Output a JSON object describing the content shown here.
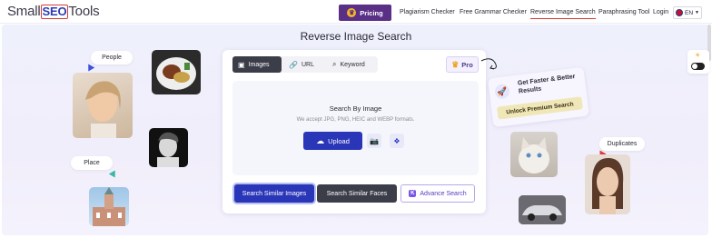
{
  "brand": {
    "logo_pre": "Small",
    "logo_mid": "SEO",
    "logo_post": "Tools"
  },
  "nav": {
    "pricing": "Pricing",
    "links": [
      "Plagiarism Checker",
      "Free Grammar Checker",
      "Reverse Image Search",
      "Paraphrasing Tool",
      "Login"
    ],
    "lang": "EN"
  },
  "hero": {
    "title": "Reverse Image Search"
  },
  "tabs": [
    {
      "label": "Images",
      "icon": "image-icon"
    },
    {
      "label": "URL",
      "icon": "link-icon"
    },
    {
      "label": "Keyword",
      "icon": "search-icon"
    }
  ],
  "pro_label": "Pro",
  "upload_area": {
    "heading": "Search By Image",
    "formats": "We accept JPG, PNG, HEIC and WEBP formats.",
    "upload_label": "Upload"
  },
  "actions": {
    "similar_images": "Search Similar Images",
    "similar_faces": "Search Similar Faces",
    "advance": "Advance Search"
  },
  "promo": {
    "headline": "Get Faster & Better Results",
    "cta": "Unlock Premium Search"
  },
  "tags": {
    "people": "People",
    "place": "Place",
    "duplicates": "Duplicates"
  },
  "colors": {
    "primary": "#2a36b8",
    "pricing": "#5a2f86",
    "dark": "#3b3d49",
    "accent_red": "#d63a3a"
  }
}
